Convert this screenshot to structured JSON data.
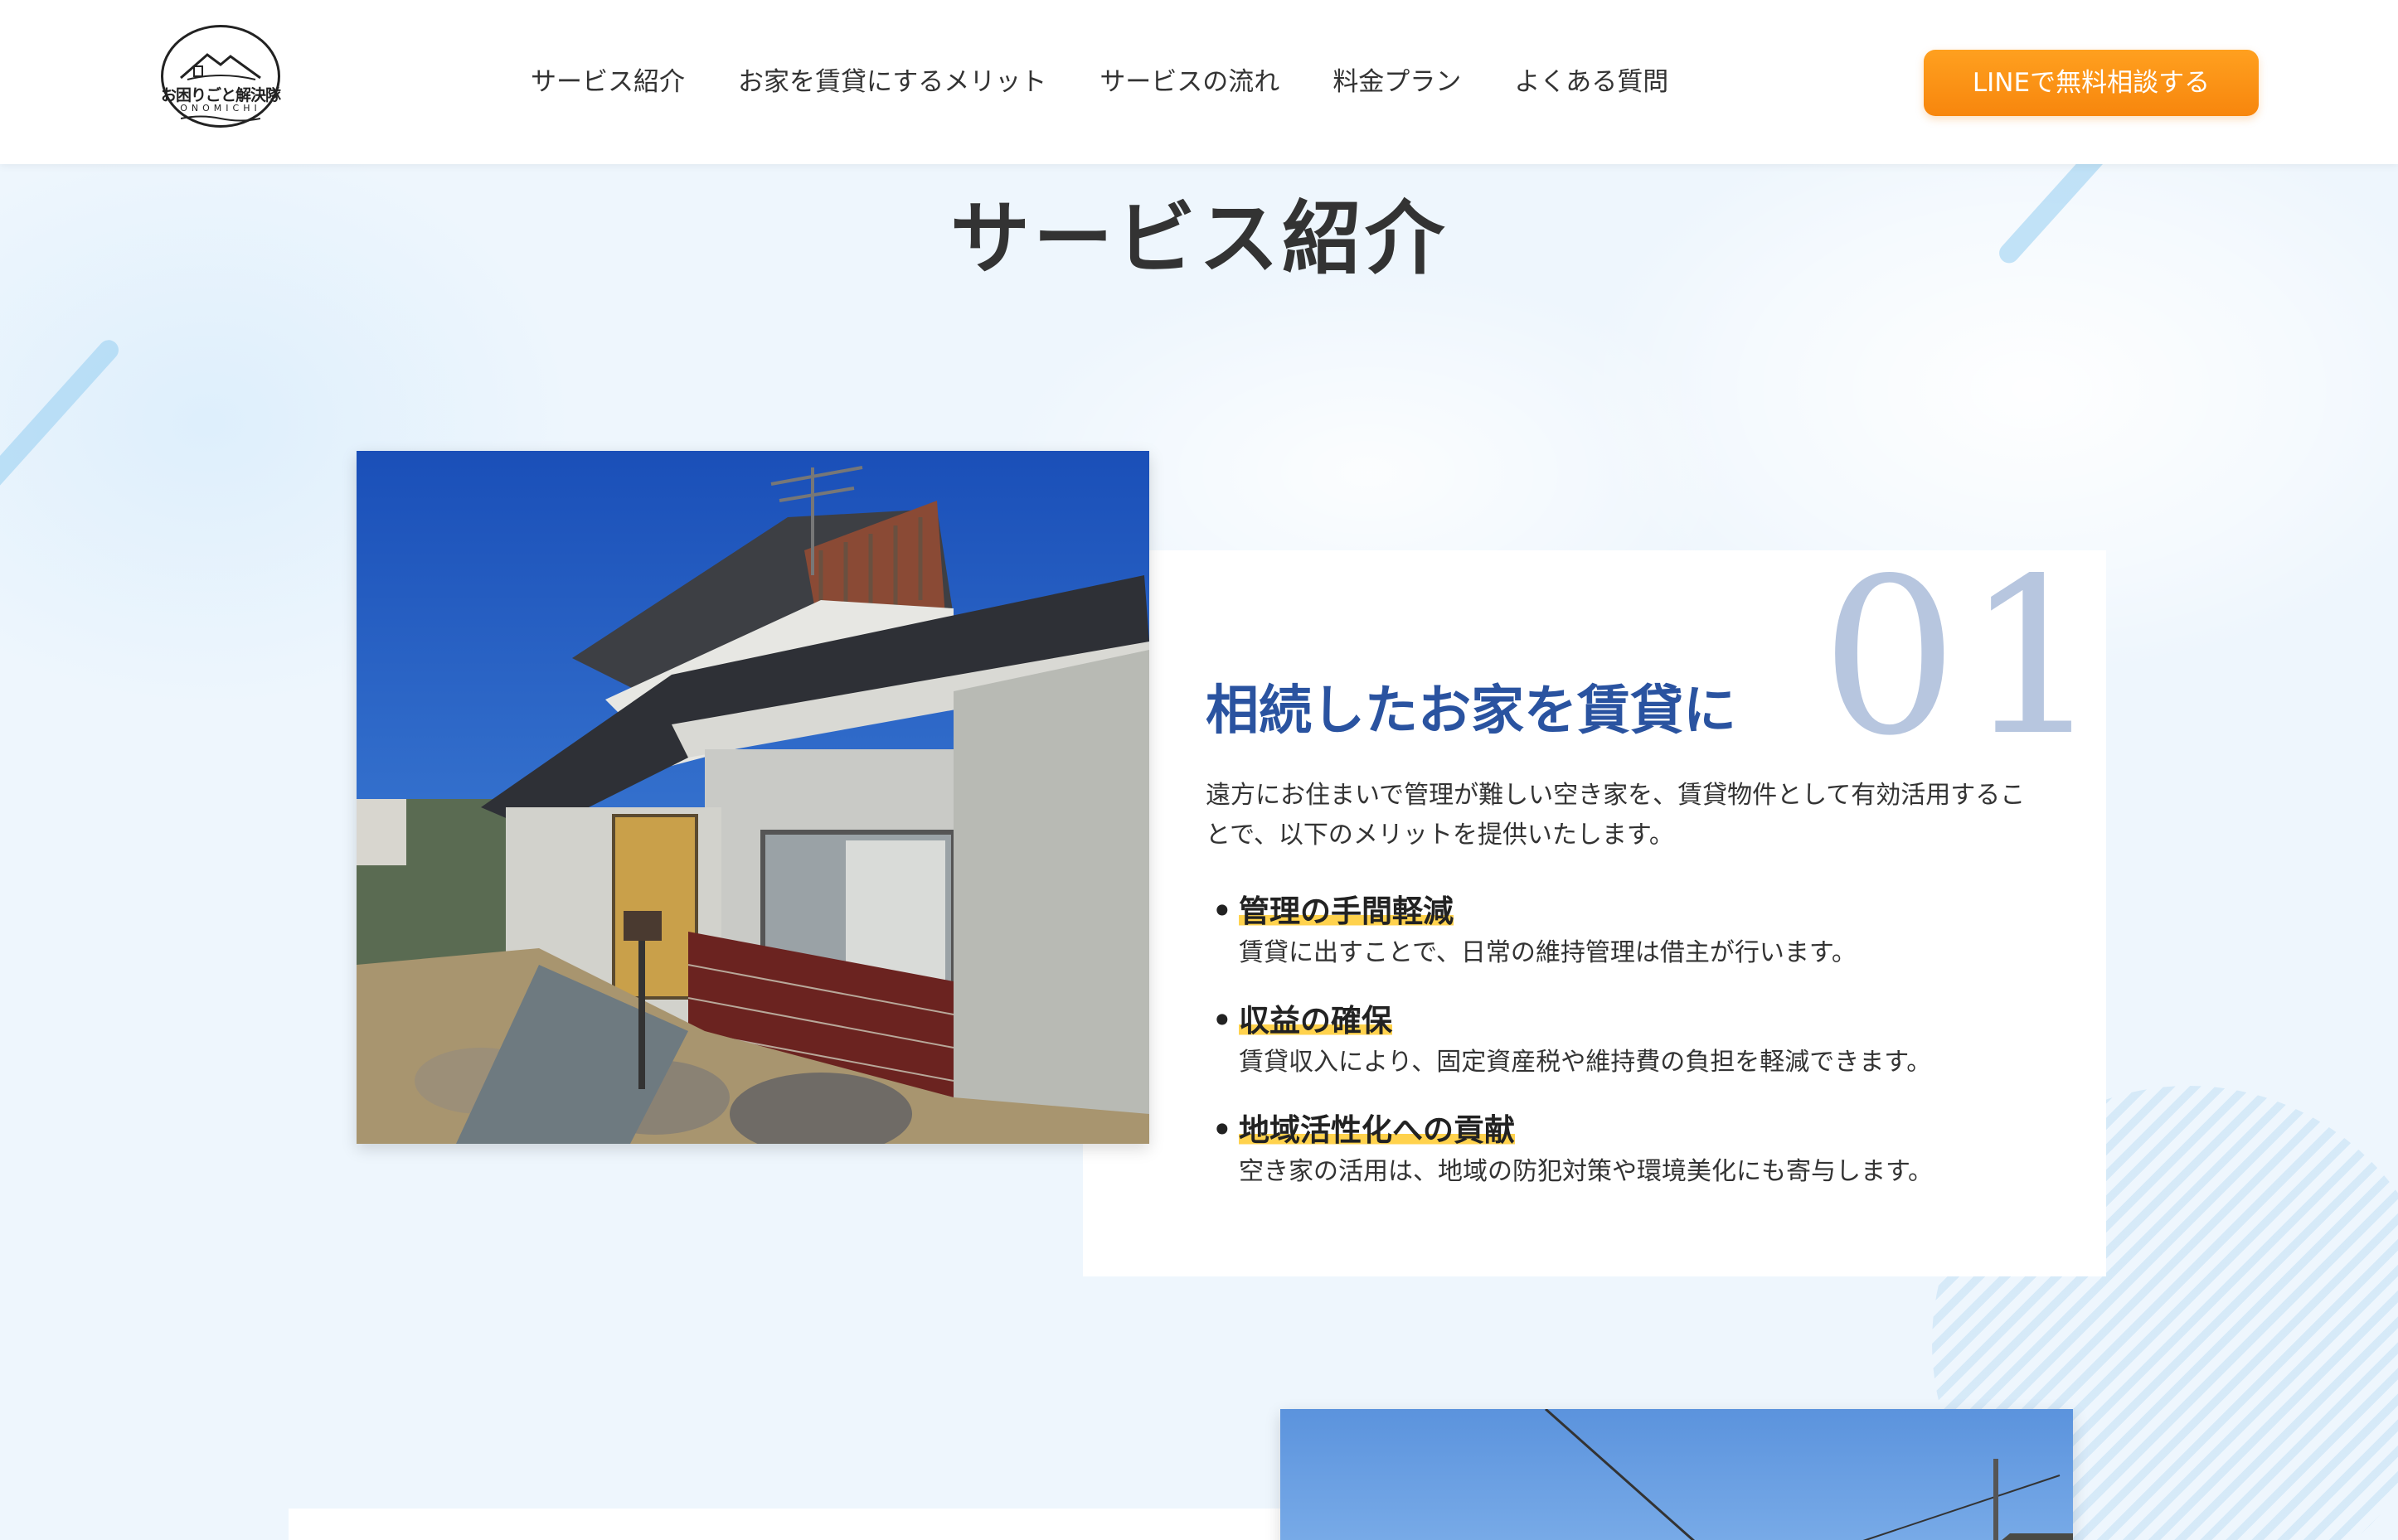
{
  "header": {
    "logo": {
      "main": "お困りごと解決隊",
      "sub": "ONOMICHI"
    },
    "nav": [
      {
        "label": "サービス紹介"
      },
      {
        "label": "お家を賃貸にするメリット"
      },
      {
        "label": "サービスの流れ"
      },
      {
        "label": "料金プラン"
      },
      {
        "label": "よくある質問"
      }
    ],
    "cta_label": "LINEで無料相談する"
  },
  "section": {
    "title": "サービス紹介"
  },
  "service1": {
    "number": "01",
    "heading": "相続したお家を賃貸に",
    "description": "遠方にお住まいで管理が難しい空き家を、賃貸物件として有効活用することで、以下のメリットを提供いたします。",
    "benefits": [
      {
        "title": "管理の手間軽減",
        "text": "賃貸に出すことで、日常の維持管理は借主が行います。"
      },
      {
        "title": "収益の確保",
        "text": "賃貸収入により、固定資産税や維持費の負担を軽減できます。"
      },
      {
        "title": "地域活性化への貢献",
        "text": "空き家の活用は、地域の防犯対策や環境美化にも寄与します。"
      }
    ]
  },
  "colors": {
    "accent_orange": "#f7860d",
    "heading_blue": "#2a53a0",
    "number_blue": "#b7c6df",
    "highlight_yellow": "#ffd24d",
    "background": "#eef6fd"
  }
}
